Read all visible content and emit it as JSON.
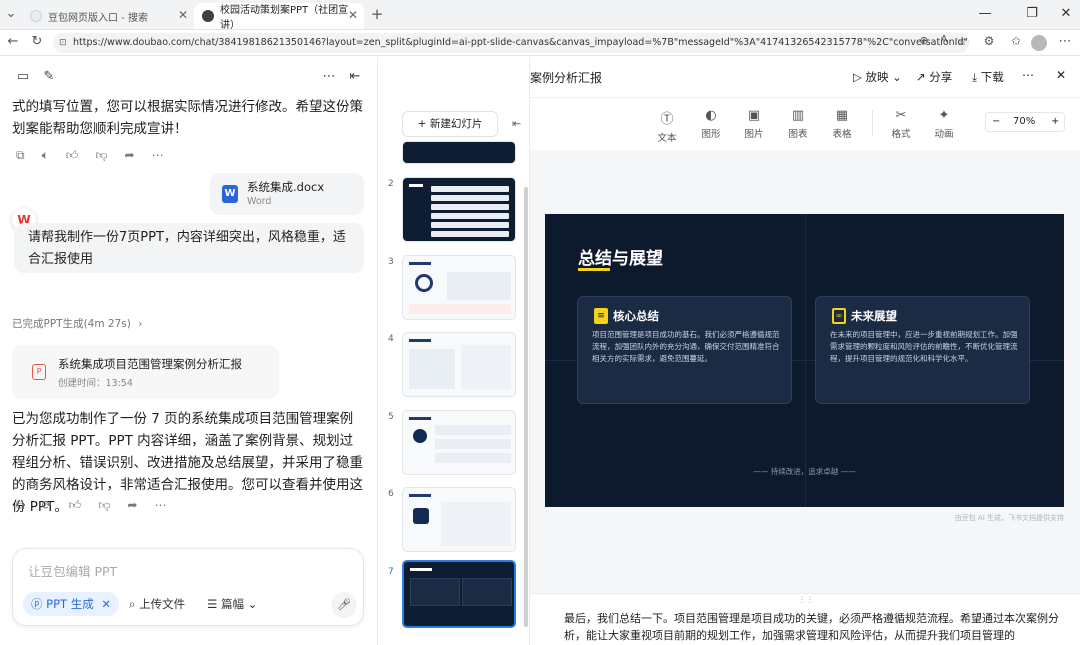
{
  "browser": {
    "tabs": [
      {
        "title": "豆包网页版入口 - 搜索"
      },
      {
        "title": "校园活动策划案PPT（社团宣讲）"
      }
    ],
    "url": "https://www.doubao.com/chat/38419818621350146?layout=zen_split&pluginId=ai-ppt-slide-canvas&canvas_impayload=%7B\"messageId\"%3A\"41741326542315778\"%2C\"conversationId\"%3..."
  },
  "chat": {
    "prev_reply": "式的填写位置，您可以根据实际情况进行修改。希望这份策划案能帮助您顺利完成宣讲！",
    "attachment": {
      "name": "系统集成.docx",
      "type": "Word",
      "icon": "W"
    },
    "user_message": "请帮我制作一份7页PPT，内容详细突出，风格稳重，适合汇报使用",
    "status": "已完成PPT生成(4m 27s)",
    "ppt_card": {
      "title": "系统集成项目范围管理案例分析汇报",
      "created": "创建时间：13:54"
    },
    "reply": "已为您成功制作了一份 7 页的系统集成项目范围管理案例分析汇报 PPT。PPT 内容详细，涵盖了案例背景、规划过程组分析、错误识别、改进措施及总结展望，并采用了稳重的商务风格设计，非常适合汇报使用。您可以查看并使用这份 PPT。",
    "input_placeholder": "让豆包编辑 PPT",
    "chips": {
      "ppt": "PPT 生成",
      "upload": "上传文件",
      "length": "篇幅"
    }
  },
  "editor": {
    "title": "系统集成项目范围管理案例分析汇报",
    "play": "放映",
    "share": "分享",
    "download": "下载",
    "new_slide": "新建幻灯片",
    "tools": [
      "文本",
      "图形",
      "图片",
      "图表",
      "表格",
      "格式",
      "动画"
    ],
    "zoom": "70%",
    "slide_numbers": [
      "2",
      "3",
      "4",
      "5",
      "6",
      "7"
    ],
    "slide": {
      "title": "总结与展望",
      "cards": [
        {
          "heading": "核心总结",
          "body": "项目范围管理是项目成功的基石。我们必须严格遵循规范流程，加强团队内外的充分沟通，确保交付范围精准符合相关方的实际需求，避免范围蔓延。"
        },
        {
          "heading": "未来展望",
          "body": "在未来的项目管理中，应进一步重视前期规划工作。加强需求管理的颗粒度和风险评估的前瞻性，不断优化管理流程，提升项目管理的规范化和科学化水平。"
        }
      ],
      "footer": "—— 持续改进，追求卓越 ——"
    },
    "watermark": "由豆包 AI 生成，飞书文档提供支持",
    "notes": "最后，我们总结一下。项目范围管理是项目成功的关键，必须严格遵循规范流程。希望通过本次案例分析，能让大家重视项目前期的规划工作，加强需求管理和风险评估，从而提升我们项目管理的"
  }
}
